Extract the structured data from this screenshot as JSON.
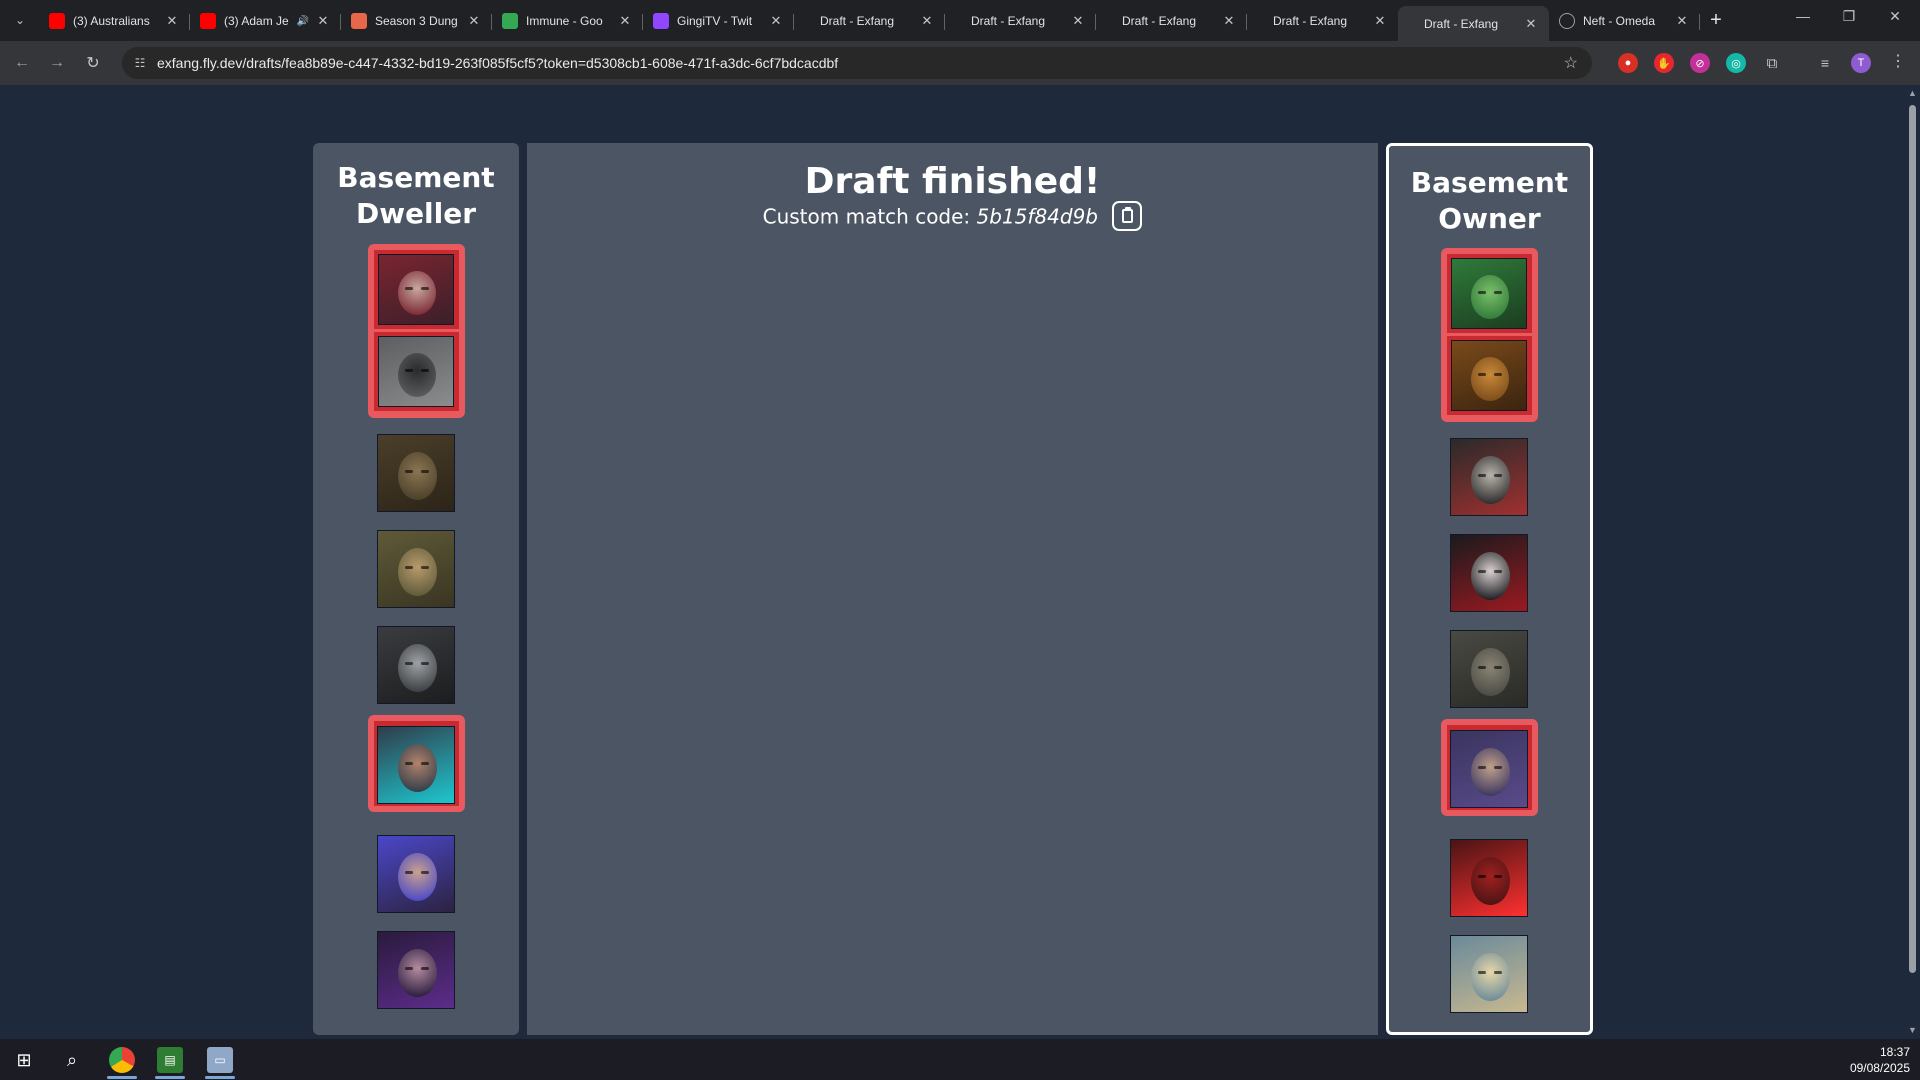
{
  "browser": {
    "tabs": [
      {
        "title": "(3) Australians",
        "favicon": "youtube-icon",
        "color": "#ff0000",
        "active": false
      },
      {
        "title": "(3) Adam Je",
        "favicon": "youtube-icon",
        "color": "#ff0000",
        "active": false,
        "audio": true
      },
      {
        "title": "Season 3 Dung",
        "favicon": "dungeon-icon",
        "color": "#e8664a",
        "active": false
      },
      {
        "title": "Immune - Goo",
        "favicon": "google-drive-icon",
        "color": "#34a853",
        "active": false
      },
      {
        "title": "GingiTV - Twit",
        "favicon": "twitch-icon",
        "color": "#9146ff",
        "active": false
      },
      {
        "title": "Draft - Exfang",
        "favicon": "",
        "active": false
      },
      {
        "title": "Draft - Exfang",
        "favicon": "",
        "active": false
      },
      {
        "title": "Draft - Exfang",
        "favicon": "",
        "active": false
      },
      {
        "title": "Draft - Exfang",
        "favicon": "",
        "active": false
      },
      {
        "title": "Draft - Exfang",
        "favicon": "",
        "active": true
      },
      {
        "title": "Neft - Omeda",
        "favicon": "globe-icon",
        "color": "#9aa0a6",
        "active": false
      }
    ],
    "url": "exfang.fly.dev/drafts/fea8b89e-c447-4332-bd19-263f085f5cf5?token=d5308cb1-608e-471f-a3dc-6cf7bdcacdbf",
    "profile_initial": "T"
  },
  "draft": {
    "left_team": {
      "name": "Basement Dweller",
      "bans": [
        {
          "icon": "hero-portrait-witch-hat",
          "colors": [
            "#7a2530",
            "#c8a7a0",
            "#3b1f2a"
          ]
        },
        {
          "icon": "hero-portrait-wolf",
          "colors": [
            "#5c5e60",
            "#2a2b2d",
            "#8a8c8e"
          ]
        }
      ],
      "picks": [
        {
          "icon": "hero-portrait-beast",
          "picked": false,
          "colors": [
            "#4b3f2a",
            "#8a7552",
            "#2c2418"
          ]
        },
        {
          "icon": "hero-portrait-soldier",
          "picked": false,
          "colors": [
            "#5e5a38",
            "#b89a6d",
            "#3a3522"
          ]
        },
        {
          "icon": "hero-portrait-dragon",
          "picked": false,
          "colors": [
            "#3a3c3f",
            "#9ea2a6",
            "#1c1d1f"
          ]
        },
        {
          "icon": "hero-portrait-gunner",
          "picked": true,
          "colors": [
            "#2f3d4a",
            "#b3826a",
            "#1ec7d0"
          ]
        },
        {
          "icon": "hero-portrait-mage",
          "picked": false,
          "colors": [
            "#4a47c9",
            "#c9a28d",
            "#2c2340"
          ]
        },
        {
          "icon": "hero-portrait-hooded",
          "picked": false,
          "colors": [
            "#2a1b3d",
            "#b48ca1",
            "#5c2c8a"
          ]
        }
      ]
    },
    "right_team": {
      "name": "Basement Owner",
      "bans": [
        {
          "icon": "hero-portrait-goblin",
          "colors": [
            "#2f7a3a",
            "#7bbf6a",
            "#1c3d20"
          ]
        },
        {
          "icon": "hero-portrait-monkey-king",
          "colors": [
            "#7a4a1a",
            "#c88a3a",
            "#3b2410"
          ]
        }
      ],
      "picks": [
        {
          "icon": "hero-portrait-sawblade",
          "picked": false,
          "colors": [
            "#2a2a2a",
            "#b8b2aa",
            "#a03030"
          ]
        },
        {
          "icon": "hero-portrait-vampire",
          "picked": false,
          "colors": [
            "#1a1a1e",
            "#d8d0cf",
            "#9a1a20"
          ]
        },
        {
          "icon": "hero-portrait-boar",
          "picked": false,
          "colors": [
            "#4a4a44",
            "#8a8474",
            "#2a2a26"
          ]
        },
        {
          "icon": "hero-portrait-headband",
          "picked": true,
          "colors": [
            "#3a3560",
            "#c0a08a",
            "#5a4a8a"
          ]
        },
        {
          "icon": "hero-portrait-red-eyes",
          "picked": false,
          "colors": [
            "#4a1414",
            "#a02020",
            "#ff3030"
          ]
        },
        {
          "icon": "hero-portrait-blonde",
          "picked": false,
          "colors": [
            "#6a8a9a",
            "#e8d7a8",
            "#c8b890"
          ]
        }
      ]
    },
    "title": "Draft finished!",
    "match_code_label": "Custom match code:",
    "match_code": "5b15f84d9b"
  },
  "taskbar": {
    "time": "18:37",
    "date": "09/08/2025"
  }
}
